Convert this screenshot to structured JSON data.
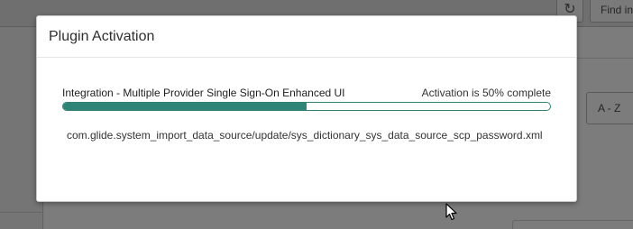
{
  "background": {
    "find_label": "Find in",
    "sort_label": "A - Z",
    "refresh_icon": "refresh-icon"
  },
  "modal": {
    "title": "Plugin Activation",
    "plugin_name": "Integration - Multiple Provider Single Sign-On Enhanced UI",
    "status_text": "Activation is 50% complete",
    "progress_percent": 50,
    "detail_text": "com.glide.system_import_data_source/update/sys_dictionary_sys_data_source_scp_password.xml"
  },
  "colors": {
    "progress": "#2e8577",
    "overlay": "#797979"
  }
}
